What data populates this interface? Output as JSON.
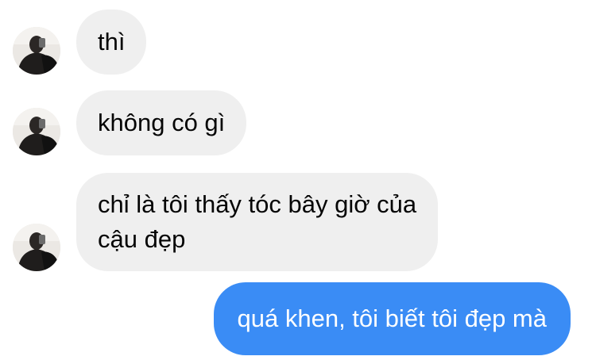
{
  "conversation": {
    "messages": [
      {
        "sender": "other",
        "lines": [
          "thì"
        ]
      },
      {
        "sender": "other",
        "lines": [
          "không có gì"
        ]
      },
      {
        "sender": "other",
        "lines": [
          "chỉ là tôi thấy tóc bây giờ của",
          "cậu đẹp"
        ]
      },
      {
        "sender": "me",
        "lines": [
          "quá khen, tôi biết tôi đẹp mà"
        ]
      }
    ]
  },
  "colors": {
    "received_bubble": "#efefef",
    "sent_bubble": "#3a8cf5",
    "received_text": "#050505",
    "sent_text": "#ffffff"
  },
  "icons": {
    "avatar": "contact-avatar-photo"
  }
}
